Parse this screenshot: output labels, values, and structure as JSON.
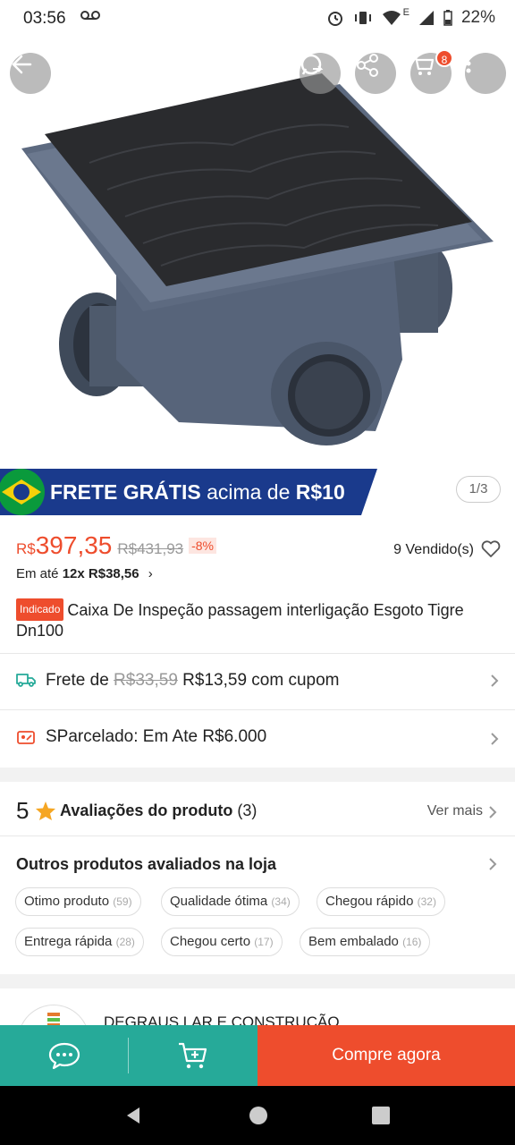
{
  "status_bar": {
    "time": "03:56",
    "voicemail_icon": "voicemail-icon",
    "network_label": "E",
    "battery": "22%"
  },
  "hero": {
    "cart_count": "8",
    "image_description_icon": "product-image"
  },
  "banner": {
    "text_bold": "FRETE GRÁTIS",
    "text_light": "acima de",
    "text_amount": "R$10",
    "colors": {
      "bg": "#1a3a8c",
      "flag_green": "#0a9a3c",
      "flag_yellow": "#f5d10a"
    }
  },
  "page_indicator": "1/3",
  "price": {
    "currency": "R$",
    "value": "397,35",
    "old": "R$431,93",
    "discount": "-8%",
    "sold": "9 Vendido(s)",
    "installments_prefix": "Em até",
    "installments_value": "12x R$38,56",
    "installments_chevron": "›"
  },
  "product": {
    "tag": "Indicado",
    "title": "Caixa De Inspeção passagem interligação Esgoto Tigre Dn100"
  },
  "shipping": {
    "label": "Frete de",
    "old": "R$33,59",
    "new": "R$13,59 com cupom"
  },
  "installment_row": {
    "label": "SParcelado: Em Ate R$6.000"
  },
  "reviews": {
    "score": "5",
    "label": "Avaliações do produto",
    "count": "(3)",
    "see_more": "Ver mais"
  },
  "store_reviews": {
    "label": "Outros produtos avaliados na loja",
    "chips": [
      {
        "label": "Otimo produto",
        "count": "(59)"
      },
      {
        "label": "Qualidade ótima",
        "count": "(34)"
      },
      {
        "label": "Chegou rápido",
        "count": "(32)"
      },
      {
        "label": "Entrega rápida",
        "count": "(28)"
      },
      {
        "label": "Chegou certo",
        "count": "(17)"
      },
      {
        "label": "Bem embalado",
        "count": "(16)"
      }
    ]
  },
  "store": {
    "name": "DEGRAUS LAR E CONSTRUÇÃO"
  },
  "actions": {
    "buy_label": "Compre agora",
    "colors": {
      "teal": "#26aa99",
      "orange": "#ee4d2d"
    }
  }
}
